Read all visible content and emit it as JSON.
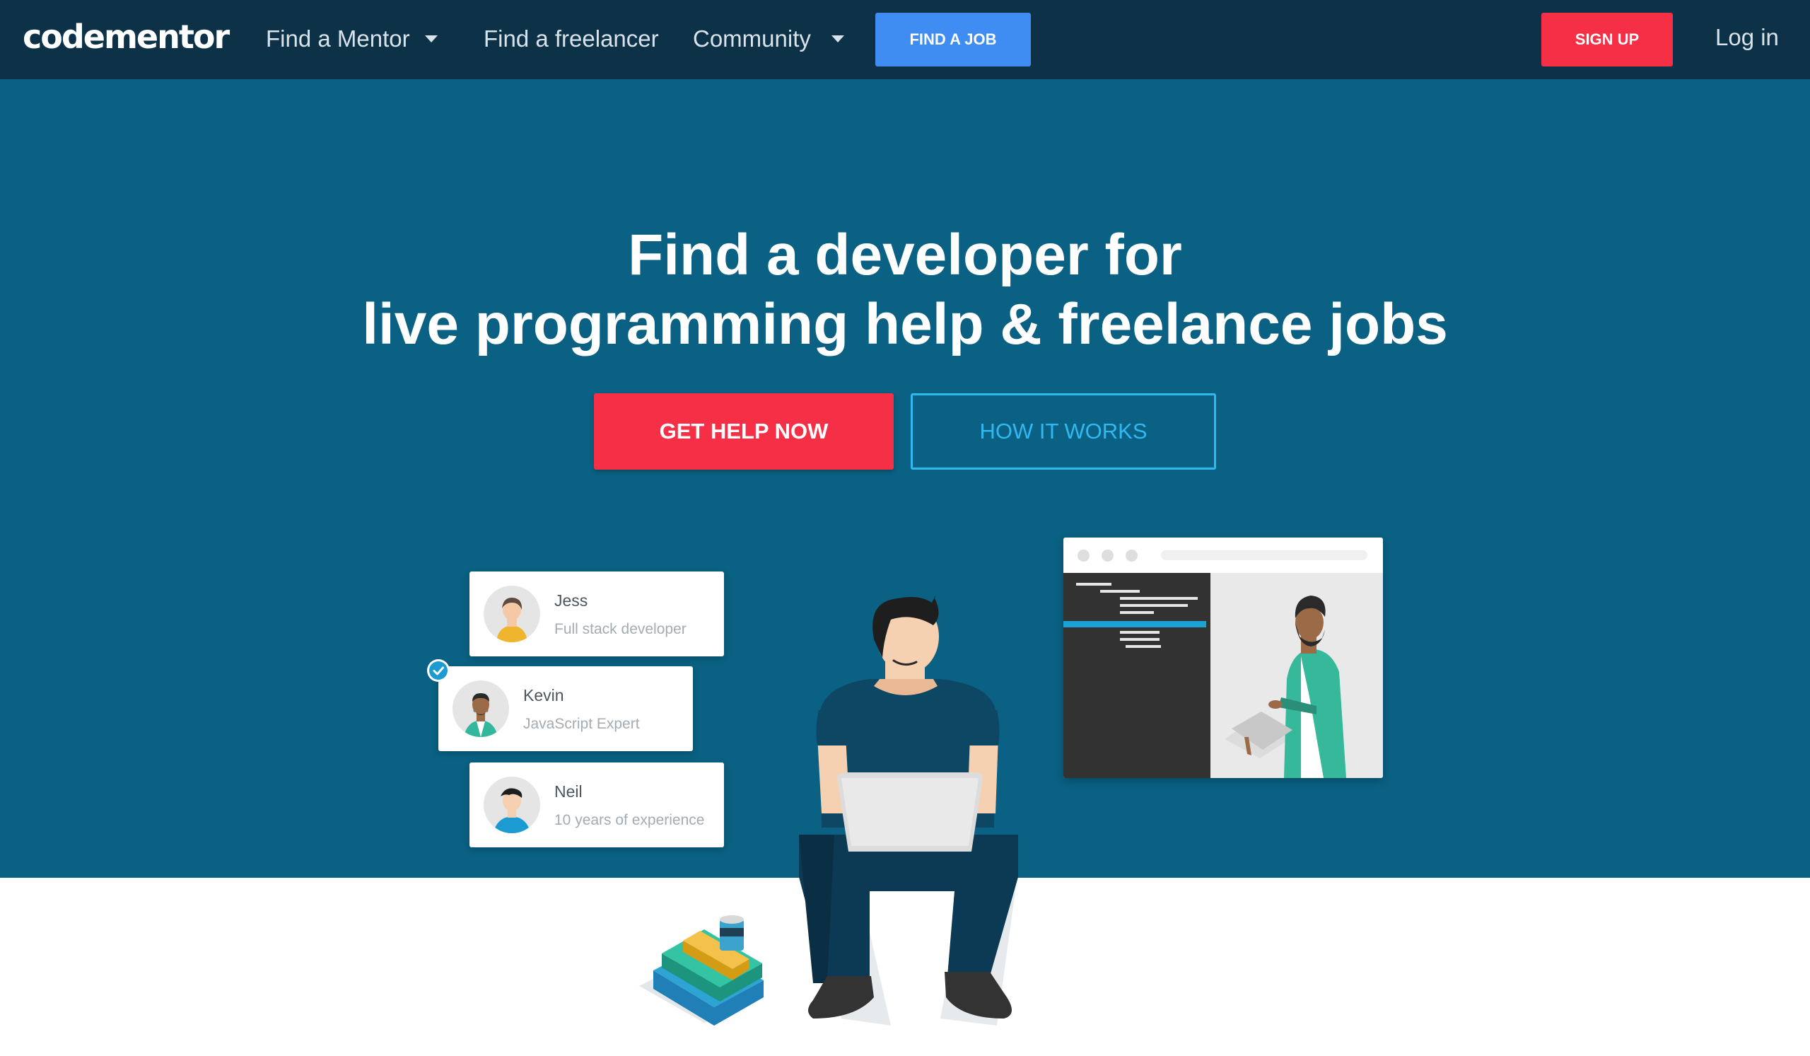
{
  "nav": {
    "logo": "codementor",
    "find_mentor": "Find a Mentor",
    "find_freelancer": "Find a freelancer",
    "community": "Community",
    "find_job": "FIND A JOB",
    "sign_up": "SIGN UP",
    "log_in": "Log in"
  },
  "hero": {
    "title_line1": "Find a developer for",
    "title_line2": "live programming help & freelance jobs",
    "cta_primary": "GET HELP NOW",
    "cta_secondary": "HOW IT WORKS"
  },
  "mentors": [
    {
      "name": "Jess",
      "role": "Full stack developer"
    },
    {
      "name": "Kevin",
      "role": "JavaScript Expert",
      "selected": true
    },
    {
      "name": "Neil",
      "role": "10 years of experience"
    }
  ],
  "colors": {
    "nav_bg": "#0d3248",
    "hero_bg": "#0a6183",
    "accent_red": "#f52f45",
    "accent_blue": "#3f8cf2",
    "outline_cyan": "#31b8f0"
  }
}
